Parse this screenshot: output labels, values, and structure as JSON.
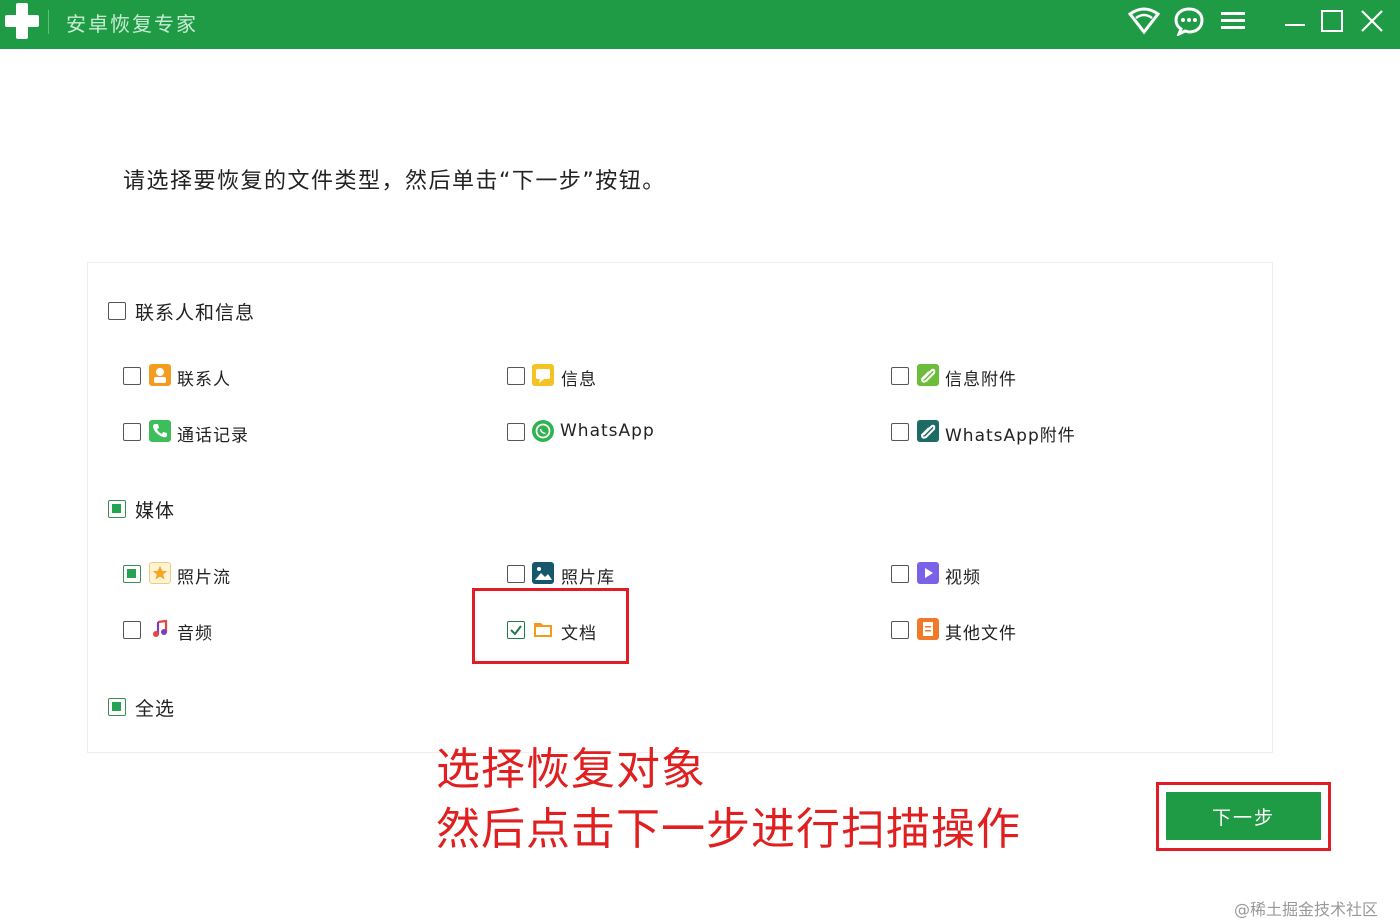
{
  "window": {
    "title": "安卓恢复专家",
    "icons": [
      "wifi-icon",
      "chat-icon",
      "menu-icon",
      "minimize-icon",
      "maximize-icon",
      "close-icon"
    ]
  },
  "instruction": "请选择要恢复的文件类型，然后单击“下一步”按钮。",
  "groups": {
    "contacts_messages": {
      "label": "联系人和信息",
      "state": "unchecked",
      "items": [
        {
          "label": "联系人",
          "checked": false,
          "icon": "contact-icon",
          "color": "#f39c1f"
        },
        {
          "label": "信息",
          "checked": false,
          "icon": "message-icon",
          "color": "#f5c226"
        },
        {
          "label": "信息附件",
          "checked": false,
          "icon": "attachment-icon",
          "color": "#6cbd3c"
        },
        {
          "label": "通话记录",
          "checked": false,
          "icon": "phone-icon",
          "color": "#3cbf5a"
        },
        {
          "label": "WhatsApp",
          "checked": false,
          "icon": "whatsapp-icon",
          "color": "#2fb34e"
        },
        {
          "label": "WhatsApp附件",
          "checked": false,
          "icon": "whatsapp-attachment-icon",
          "color": "#1e6b66"
        }
      ]
    },
    "media": {
      "label": "媒体",
      "state": "partial",
      "items": [
        {
          "label": "照片流",
          "checked": true,
          "icon": "star-photo-icon",
          "color": "#f5a623"
        },
        {
          "label": "照片库",
          "checked": false,
          "icon": "gallery-icon",
          "color": "#16586b"
        },
        {
          "label": "视频",
          "checked": false,
          "icon": "video-icon",
          "color": "#7b61e8"
        },
        {
          "label": "音频",
          "checked": false,
          "icon": "audio-icon",
          "color": "#e8463c"
        },
        {
          "label": "文档",
          "checked": true,
          "icon": "folder-icon",
          "color": "#f39a1e"
        },
        {
          "label": "其他文件",
          "checked": false,
          "icon": "file-icon",
          "color": "#f07a2a"
        }
      ]
    },
    "select_all": {
      "label": "全选",
      "state": "partial"
    }
  },
  "annotation": {
    "line1": "选择恢复对象",
    "line2": "然后点击下一步进行扫描操作",
    "color": "#e02020"
  },
  "next_button": {
    "label": "下一步",
    "color": "#1f9a45"
  },
  "watermark": "@稀土掘金技术社区"
}
